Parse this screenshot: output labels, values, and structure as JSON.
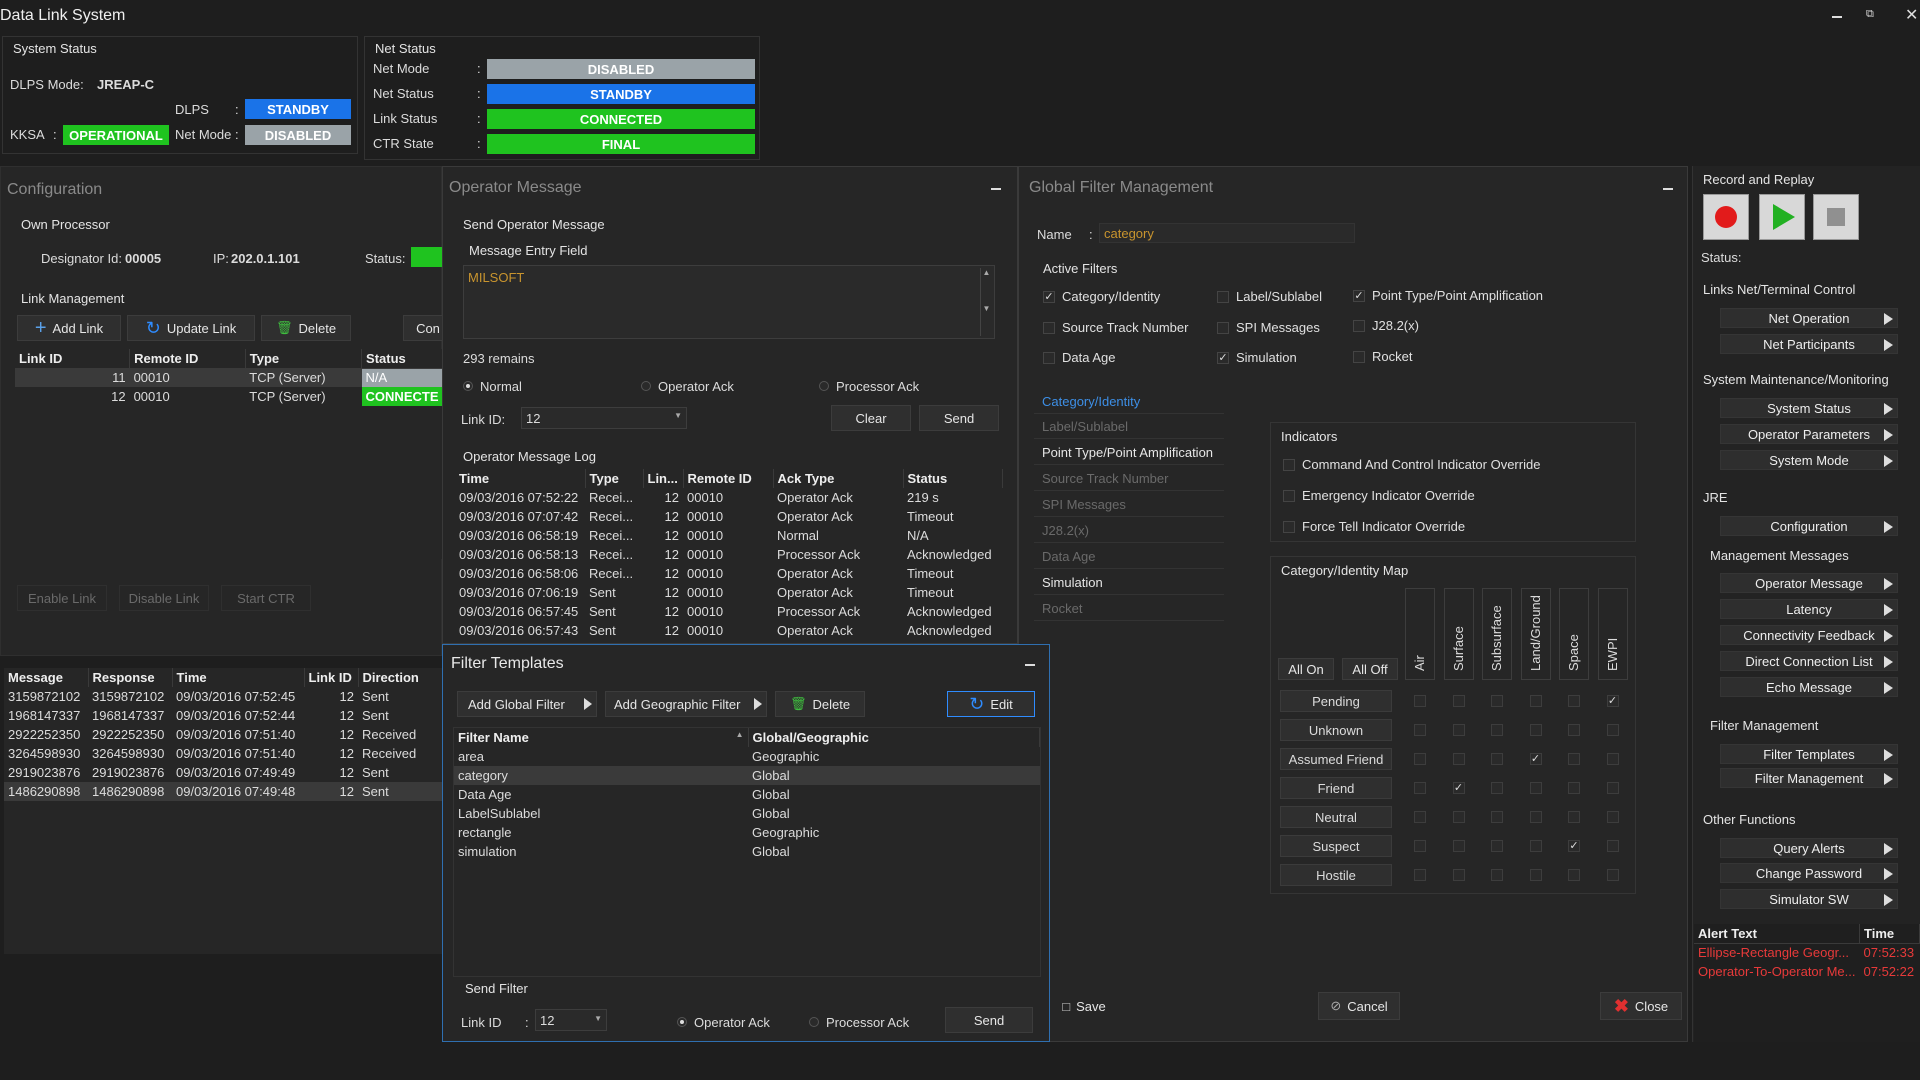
{
  "window": {
    "title": "Data Link System"
  },
  "system_status": {
    "title": "System Status",
    "dlps_mode_label": "DLPS Mode:",
    "dlps_mode": "JREAP-C",
    "dlps_label": "DLPS",
    "dlps_value": "STANDBY",
    "kksa_label": "KKSA",
    "kksa_value": "OPERATIONAL",
    "net_mode_label": "Net Mode :",
    "net_mode_value": "DISABLED"
  },
  "net_status": {
    "title": "Net Status",
    "rows": [
      {
        "label": "Net Mode",
        "value": "DISABLED",
        "color": "#9aa3a8"
      },
      {
        "label": "Net Status",
        "value": "STANDBY",
        "color": "#1a73e8"
      },
      {
        "label": "Link Status",
        "value": "CONNECTED",
        "color": "#1fc31f"
      },
      {
        "label": "CTR State",
        "value": "FINAL",
        "color": "#1fc31f"
      }
    ]
  },
  "configuration": {
    "title": "Configuration",
    "own_processor": "Own Processor",
    "designator_label": "Designator Id:",
    "designator": "00005",
    "ip_label": "IP:",
    "ip": "202.0.1.101",
    "status_label": "Status:",
    "link_mgmt": "Link Management",
    "add_link": "Add Link",
    "update_link": "Update Link",
    "delete": "Delete",
    "con": "Con",
    "columns": [
      "Link ID",
      "Remote ID",
      "Type",
      "Status"
    ],
    "rows": [
      {
        "link": "11",
        "remote": "00010",
        "type": "TCP (Server)",
        "status": "N/A",
        "status_color": "#9aa3a8"
      },
      {
        "link": "12",
        "remote": "00010",
        "type": "TCP (Server)",
        "status": "CONNECTE",
        "status_color": "#1fc31f"
      }
    ],
    "enable_link": "Enable Link",
    "disable_link": "Disable Link",
    "start_ctr": "Start CTR"
  },
  "echo_log": {
    "columns": [
      "Message",
      "Response",
      "Time",
      "Link ID",
      "Direction"
    ],
    "rows": [
      [
        "3159872102",
        "3159872102",
        "09/03/2016 07:52:45",
        "12",
        "Sent"
      ],
      [
        "1968147337",
        "1968147337",
        "09/03/2016 07:52:44",
        "12",
        "Sent"
      ],
      [
        "2922252350",
        "2922252350",
        "09/03/2016 07:51:40",
        "12",
        "Received"
      ],
      [
        "3264598930",
        "3264598930",
        "09/03/2016 07:51:40",
        "12",
        "Received"
      ],
      [
        "2919023876",
        "2919023876",
        "09/03/2016 07:49:49",
        "12",
        "Sent"
      ],
      [
        "1486290898",
        "1486290898",
        "09/03/2016 07:49:48",
        "12",
        "Sent"
      ]
    ]
  },
  "operator_message": {
    "title": "Operator Message",
    "send_title": "Send Operator Message",
    "entry_title": "Message Entry Field",
    "entry_text": "MILSOFT",
    "remains": "293 remains",
    "radio_normal": "Normal",
    "radio_op_ack": "Operator Ack",
    "radio_proc_ack": "Processor Ack",
    "link_id_label": "Link ID:",
    "link_id": "12",
    "clear": "Clear",
    "send": "Send",
    "log_title": "Operator Message Log",
    "log_columns": [
      "Time",
      "Type",
      "Lin...",
      "Remote ID",
      "Ack Type",
      "Status"
    ],
    "log_rows": [
      [
        "09/03/2016 07:52:22",
        "Recei...",
        "12",
        "00010",
        "Operator Ack",
        "219 s"
      ],
      [
        "09/03/2016 07:07:42",
        "Recei...",
        "12",
        "00010",
        "Operator Ack",
        "Timeout"
      ],
      [
        "09/03/2016 06:58:19",
        "Recei...",
        "12",
        "00010",
        "Normal",
        "N/A"
      ],
      [
        "09/03/2016 06:58:13",
        "Recei...",
        "12",
        "00010",
        "Processor Ack",
        "Acknowledged"
      ],
      [
        "09/03/2016 06:58:06",
        "Recei...",
        "12",
        "00010",
        "Operator Ack",
        "Timeout"
      ],
      [
        "09/03/2016 07:06:19",
        "Sent",
        "12",
        "00010",
        "Operator Ack",
        "Timeout"
      ],
      [
        "09/03/2016 06:57:45",
        "Sent",
        "12",
        "00010",
        "Processor Ack",
        "Acknowledged"
      ],
      [
        "09/03/2016 06:57:43",
        "Sent",
        "12",
        "00010",
        "Operator Ack",
        "Acknowledged"
      ]
    ]
  },
  "filter_templates": {
    "title": "Filter Templates",
    "add_global": "Add Global Filter",
    "add_geo": "Add Geographic Filter",
    "delete": "Delete",
    "edit": "Edit",
    "columns": [
      "Filter Name",
      "Global/Geographic"
    ],
    "rows": [
      [
        "area",
        "Geographic"
      ],
      [
        "category",
        "Global"
      ],
      [
        "Data  Age",
        "Global"
      ],
      [
        "LabelSublabel",
        "Global"
      ],
      [
        "rectangle",
        "Geographic"
      ],
      [
        "simulation",
        "Global"
      ]
    ],
    "send_filter": "Send Filter",
    "link_id_label": "Link ID",
    "link_id": "12",
    "op_ack": "Operator Ack",
    "proc_ack": "Processor Ack",
    "send": "Send"
  },
  "global_filter": {
    "title": "Global Filter Management",
    "name_label": "Name",
    "name_value": "category",
    "active_filters": "Active Filters",
    "filters": [
      {
        "label": "Category/Identity",
        "checked": true
      },
      {
        "label": "Label/Sublabel",
        "checked": false
      },
      {
        "label": "Point Type/Point Amplification",
        "checked": true
      },
      {
        "label": "Source Track Number",
        "checked": false
      },
      {
        "label": "SPI Messages",
        "checked": false
      },
      {
        "label": "J28.2(x)",
        "checked": false
      },
      {
        "label": "Data Age",
        "checked": false
      },
      {
        "label": "Simulation",
        "checked": true
      },
      {
        "label": "Rocket",
        "checked": false
      }
    ],
    "categories": [
      {
        "label": "Category/Identity",
        "state": "active"
      },
      {
        "label": "Label/Sublabel",
        "state": "dim"
      },
      {
        "label": "Point Type/Point Amplification",
        "state": "normal"
      },
      {
        "label": "Source Track Number",
        "state": "dim"
      },
      {
        "label": "SPI Messages",
        "state": "dim"
      },
      {
        "label": "J28.2(x)",
        "state": "dim"
      },
      {
        "label": "Data Age",
        "state": "dim"
      },
      {
        "label": "Simulation",
        "state": "normal"
      },
      {
        "label": "Rocket",
        "state": "dim"
      }
    ],
    "indicators_title": "Indicators",
    "indicators": [
      "Command And Control Indicator Override",
      "Emergency Indicator Override",
      "Force Tell Indicator Override"
    ],
    "map_title": "Category/Identity Map",
    "all_on": "All On",
    "all_off": "All Off",
    "map_columns": [
      "Air",
      "Surface",
      "Subsurface",
      "Land/Ground",
      "Space",
      "EWPI"
    ],
    "map_rows": [
      {
        "label": "Pending",
        "checks": [
          0,
          0,
          0,
          0,
          0,
          1
        ]
      },
      {
        "label": "Unknown",
        "checks": [
          0,
          0,
          0,
          0,
          0,
          0
        ]
      },
      {
        "label": "Assumed Friend",
        "checks": [
          0,
          0,
          0,
          1,
          0,
          0
        ]
      },
      {
        "label": "Friend",
        "checks": [
          0,
          1,
          0,
          0,
          0,
          0
        ]
      },
      {
        "label": "Neutral",
        "checks": [
          0,
          0,
          0,
          0,
          0,
          0
        ]
      },
      {
        "label": "Suspect",
        "checks": [
          0,
          0,
          0,
          0,
          1,
          0
        ]
      },
      {
        "label": "Hostile",
        "checks": [
          0,
          0,
          0,
          0,
          0,
          0
        ]
      }
    ],
    "save": "Save",
    "cancel": "Cancel",
    "close": "Close"
  },
  "sidebar": {
    "record_title": "Record and Replay",
    "status_label": "Status:",
    "groups": [
      {
        "title": "Links Net/Terminal Control",
        "items": [
          "Net Operation",
          "Net Participants"
        ]
      },
      {
        "title": "System Maintenance/Monitoring",
        "items": [
          "System Status",
          "Operator Parameters",
          "System Mode"
        ]
      },
      {
        "title": "JRE",
        "items": [
          "Configuration"
        ]
      },
      {
        "title": "Management Messages",
        "items": [
          "Operator Message",
          "Latency",
          "Connectivity Feedback",
          "Direct Connection List",
          "Echo Message"
        ]
      },
      {
        "title": "Filter Management",
        "items": [
          "Filter Templates",
          "Filter Management"
        ]
      },
      {
        "title": "Other Functions",
        "items": [
          "Query Alerts",
          "Change Password",
          "Simulator SW"
        ]
      }
    ],
    "alerts_columns": [
      "Alert Text",
      "Time"
    ],
    "alerts": [
      [
        "Ellipse-Rectangle Geogr...",
        "07:52:33"
      ],
      [
        "Operator-To-Operator Me...",
        "07:52:22"
      ]
    ]
  }
}
